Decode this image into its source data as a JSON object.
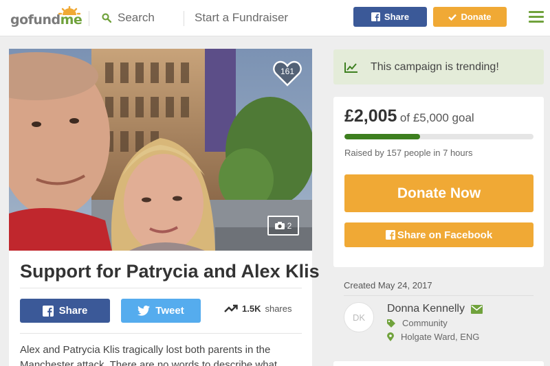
{
  "header": {
    "logo_go": "gofund",
    "logo_me": "me",
    "search_label": "Search",
    "start_label": "Start a Fundraiser",
    "share_label": "Share",
    "donate_label": "Donate"
  },
  "campaign": {
    "hearts": "161",
    "photo_count": "2",
    "title": "Support for Patrycia and Alex Klis",
    "share_label": "Share",
    "tweet_label": "Tweet",
    "shares_count": "1.5K",
    "shares_label": "shares",
    "story_line1": "Alex and Patrycia Klis tragically lost both parents in the",
    "story_line2": "Manchester attack. There are no words to describe what"
  },
  "sidebar": {
    "trending_text": "This campaign is trending!",
    "raised": "£2,005",
    "goal_text": "of £5,000 goal",
    "progress": 0.401,
    "raised_by": "Raised by 157 people in 7 hours",
    "donate_now": "Donate Now",
    "share_facebook": "Share on Facebook",
    "created": "Created May 24, 2017",
    "organizer_initials": "DK",
    "organizer_name": "Donna Kennelly",
    "category": "Community",
    "location": "Holgate Ward, ENG"
  },
  "colors": {
    "brand_green": "#70a23c",
    "facebook_blue": "#3b5998",
    "twitter_blue": "#55acee",
    "donate_orange": "#f0a935",
    "progress_green": "#3d7f1f"
  },
  "icons": [
    "search-icon",
    "facebook-icon",
    "check-icon",
    "menu-icon",
    "heart-icon",
    "camera-icon",
    "twitter-icon",
    "trending-icon",
    "envelope-icon",
    "tag-icon",
    "map-pin-icon"
  ]
}
